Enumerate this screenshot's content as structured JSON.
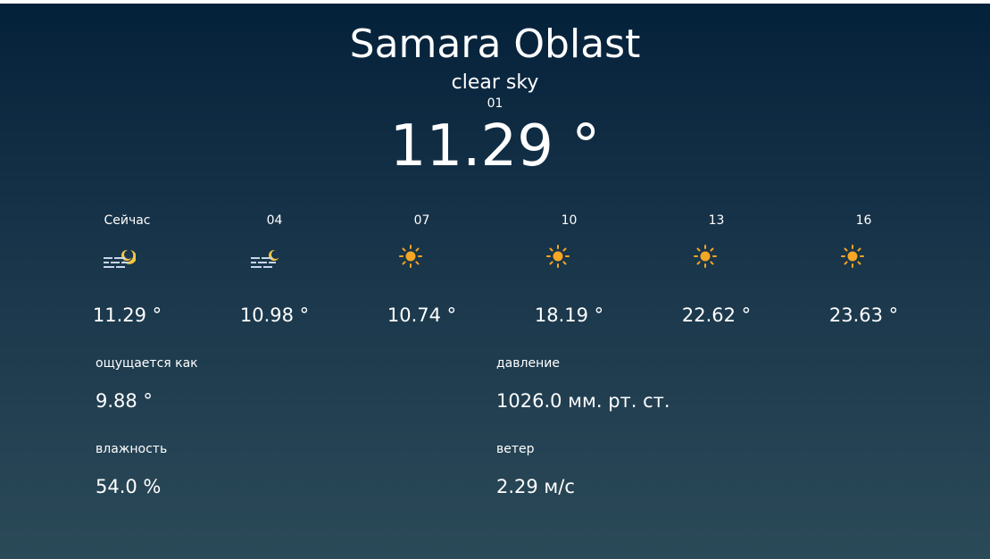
{
  "location": {
    "city": "Samara Oblast",
    "description": "clear sky",
    "code": "01",
    "temperature": "11.29 °"
  },
  "forecast": [
    {
      "time": "Сейчас",
      "icon": "fog-moon-icon",
      "temp": "11.29 °"
    },
    {
      "time": "04",
      "icon": "fog-moon-icon",
      "temp": "10.98 °"
    },
    {
      "time": "07",
      "icon": "sun-icon",
      "temp": "10.74 °"
    },
    {
      "time": "10",
      "icon": "sun-icon",
      "temp": "18.19 °"
    },
    {
      "time": "13",
      "icon": "sun-icon",
      "temp": "22.62 °"
    },
    {
      "time": "16",
      "icon": "sun-icon",
      "temp": "23.63 °"
    }
  ],
  "details": {
    "feels_like": {
      "label": "ощущается как",
      "value": "9.88 °"
    },
    "pressure": {
      "label": "давление",
      "value": "1026.0 мм. рт. ст."
    },
    "humidity": {
      "label": "влажность",
      "value": "54.0 %"
    },
    "wind": {
      "label": "ветер",
      "value": "2.29 м/с"
    }
  },
  "colors": {
    "sun": "#f5a623",
    "moon": "#f4c542",
    "fog": "#c8d6ea"
  }
}
